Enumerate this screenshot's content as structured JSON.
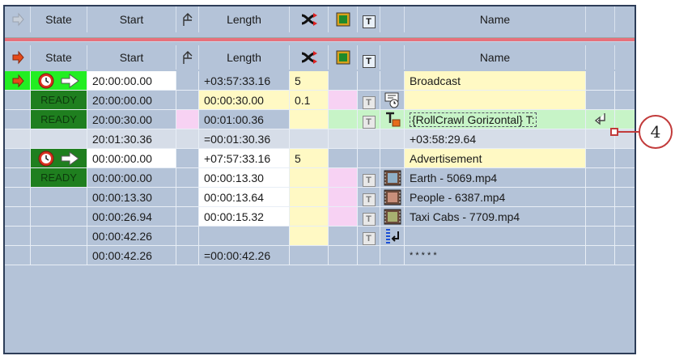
{
  "header": {
    "state": "State",
    "start": "Start",
    "length": "Length",
    "t_label": "T",
    "name": "Name"
  },
  "rows": [
    {
      "state": "",
      "start": "20:00:00.00",
      "length": "+03:57:33.16",
      "repeat": "5",
      "name": "Broadcast"
    },
    {
      "state": "READY",
      "start": "20:00:00.00",
      "length": "00:00:30.00",
      "repeat": "0.1",
      "t": "T",
      "name": ""
    },
    {
      "state": "READY",
      "start": "20:00:30.00",
      "length": "00:01:00.36",
      "repeat": "",
      "t": "T",
      "name": "{RollCrawl Gorizontal} T:"
    },
    {
      "state": "",
      "start": "20:01:30.36",
      "length": "=00:01:30.36",
      "repeat": "",
      "name": "+03:58:29.64"
    },
    {
      "state": "",
      "start": "00:00:00.00",
      "length": "+07:57:33.16",
      "repeat": "5",
      "name": "Advertisement"
    },
    {
      "state": "READY",
      "start": "00:00:00.00",
      "length": "00:00:13.30",
      "repeat": "",
      "t": "T",
      "name": "Earth - 5069.mp4"
    },
    {
      "state": "",
      "start": "00:00:13.30",
      "length": "00:00:13.64",
      "repeat": "",
      "t": "T",
      "name": "People - 6387.mp4"
    },
    {
      "state": "",
      "start": "00:00:26.94",
      "length": "00:00:15.32",
      "repeat": "",
      "t": "T",
      "name": "Taxi Cabs - 7709.mp4"
    },
    {
      "state": "",
      "start": "00:00:42.26",
      "length": "",
      "repeat": "",
      "t": "T",
      "name": ""
    },
    {
      "state": "",
      "start": "00:00:42.26",
      "length": "=00:00:42.26",
      "repeat": "",
      "name": "* * * * *"
    }
  ],
  "callout": {
    "number": "4"
  },
  "colors": {
    "panel": "#b4c3d8",
    "border": "#2d3d58",
    "playing_green": "#22ee22",
    "ready_green": "#1f7f1f",
    "yellow": "#fff9c4",
    "pink": "#f7d2f3",
    "separator": "#e7707a"
  }
}
